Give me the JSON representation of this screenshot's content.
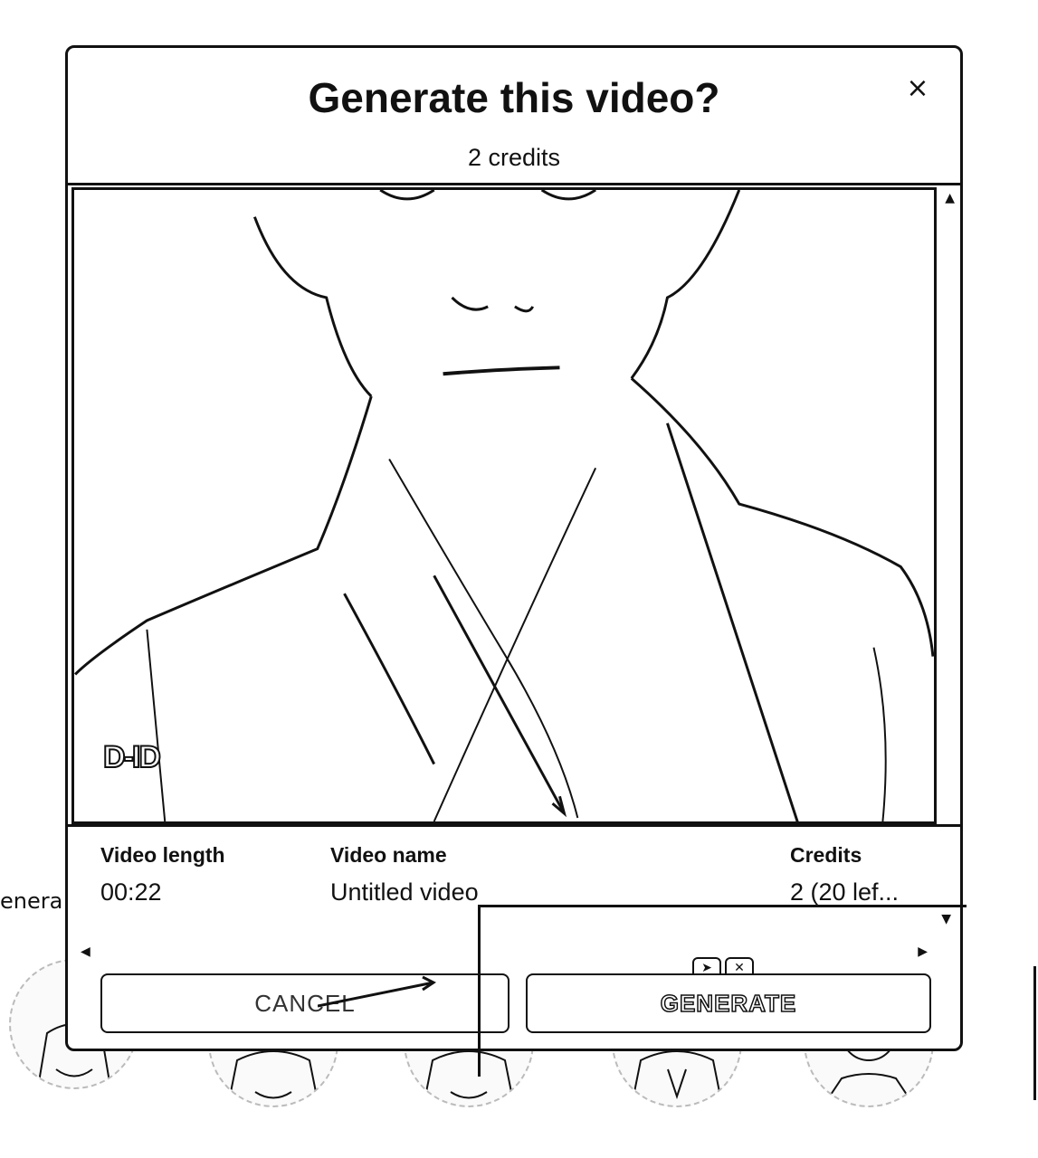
{
  "background": {
    "partial_text": "enera"
  },
  "modal": {
    "title": "Generate this video?",
    "subtitle": "2 credits",
    "close_glyph": "×"
  },
  "details": {
    "video_length_label": "Video length",
    "video_length_value": "00:22",
    "video_name_label": "Video name",
    "video_name_value": "Untitled video",
    "credits_label": "Credits",
    "credits_value": "2 (20 lef..."
  },
  "buttons": {
    "cancel_label": "CANCEL",
    "generate_label": "GENERATE"
  },
  "preview": {
    "watermark": "D-ID"
  },
  "icons": {
    "close": "close-icon",
    "scroll_up": "chevron-up-icon",
    "scroll_down": "chevron-down-icon",
    "scroll_left": "chevron-left-icon",
    "scroll_right": "chevron-right-icon",
    "annotation_arrow": "arrow-icon",
    "annotation_close": "close-icon"
  }
}
